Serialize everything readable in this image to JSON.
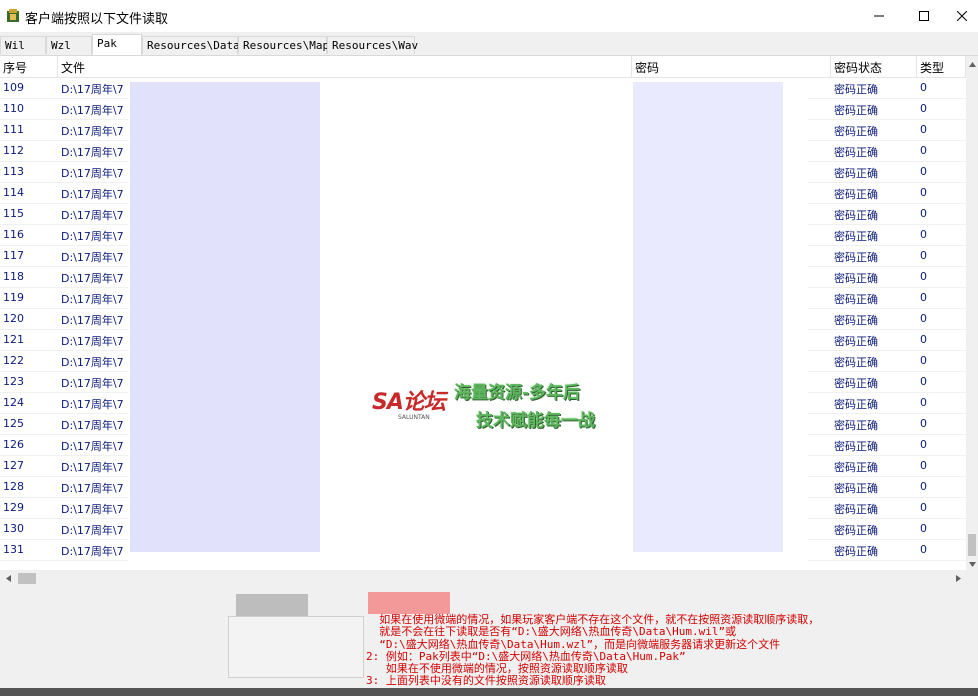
{
  "window": {
    "title": "客户端按照以下文件读取"
  },
  "tabs": [
    {
      "label": "Wil",
      "active": false
    },
    {
      "label": "Wzl",
      "active": false
    },
    {
      "label": "Pak",
      "active": true
    },
    {
      "label": "Resources\\Data",
      "active": false
    },
    {
      "label": "Resources\\Map",
      "active": false
    },
    {
      "label": "Resources\\Wav",
      "active": false
    }
  ],
  "table": {
    "columns": [
      "序号",
      "文件",
      "密码",
      "密码状态",
      "类型"
    ],
    "rows": [
      {
        "seq": "109",
        "file": "D:\\17周年\\7",
        "status": "密码正确",
        "type": "0"
      },
      {
        "seq": "110",
        "file": "D:\\17周年\\7",
        "status": "密码正确",
        "type": "0"
      },
      {
        "seq": "111",
        "file": "D:\\17周年\\7",
        "status": "密码正确",
        "type": "0"
      },
      {
        "seq": "112",
        "file": "D:\\17周年\\7",
        "status": "密码正确",
        "type": "0"
      },
      {
        "seq": "113",
        "file": "D:\\17周年\\7",
        "status": "密码正确",
        "type": "0"
      },
      {
        "seq": "114",
        "file": "D:\\17周年\\7",
        "status": "密码正确",
        "type": "0"
      },
      {
        "seq": "115",
        "file": "D:\\17周年\\7",
        "status": "密码正确",
        "type": "0"
      },
      {
        "seq": "116",
        "file": "D:\\17周年\\7",
        "status": "密码正确",
        "type": "0"
      },
      {
        "seq": "117",
        "file": "D:\\17周年\\7",
        "status": "密码正确",
        "type": "0"
      },
      {
        "seq": "118",
        "file": "D:\\17周年\\7",
        "status": "密码正确",
        "type": "0"
      },
      {
        "seq": "119",
        "file": "D:\\17周年\\7",
        "status": "密码正确",
        "type": "0"
      },
      {
        "seq": "120",
        "file": "D:\\17周年\\7",
        "status": "密码正确",
        "type": "0"
      },
      {
        "seq": "121",
        "file": "D:\\17周年\\7",
        "status": "密码正确",
        "type": "0"
      },
      {
        "seq": "122",
        "file": "D:\\17周年\\7",
        "status": "密码正确",
        "type": "0"
      },
      {
        "seq": "123",
        "file": "D:\\17周年\\7",
        "status": "密码正确",
        "type": "0"
      },
      {
        "seq": "124",
        "file": "D:\\17周年\\7",
        "status": "密码正确",
        "type": "0"
      },
      {
        "seq": "125",
        "file": "D:\\17周年\\7",
        "status": "密码正确",
        "type": "0"
      },
      {
        "seq": "126",
        "file": "D:\\17周年\\7",
        "status": "密码正确",
        "type": "0"
      },
      {
        "seq": "127",
        "file": "D:\\17周年\\7",
        "status": "密码正确",
        "type": "0"
      },
      {
        "seq": "128",
        "file": "D:\\17周年\\7",
        "status": "密码正确",
        "type": "0"
      },
      {
        "seq": "129",
        "file": "D:\\17周年\\7",
        "status": "密码正确",
        "type": "0"
      },
      {
        "seq": "130",
        "file": "D:\\17周年\\7",
        "status": "密码正确",
        "type": "0"
      },
      {
        "seq": "131",
        "file": "D:\\17周年\\7",
        "status": "密码正确",
        "type": "0"
      }
    ]
  },
  "watermark": {
    "logo": "SA论坛",
    "logo_sub": "SALUNTAN",
    "line1": "海量资源-多年后",
    "line2": "技术赋能每一战"
  },
  "notes": {
    "lines": [
      "  如果在使用微端的情况，如果玩家客户端不存在这个文件，就不在按照资源读取顺序读取，",
      "  就是不会在往下读取是否有“D:\\盛大网络\\热血传奇\\Data\\Hum.wil”或",
      "  “D:\\盛大网络\\热血传奇\\Data\\Hum.wzl”，而是向微端服务器请求更新这个文件",
      "2: 例如：Pak列表中“D:\\盛大网络\\热血传奇\\Data\\Hum.Pak”",
      "   如果在不使用微端的情况，按照资源读取顺序读取",
      "3: 上面列表中没有的文件按照资源读取顺序读取"
    ]
  },
  "colors": {
    "row_text": "#0a1a7a",
    "note_text": "#d40000",
    "watermark_green": "#5fb85f",
    "logo_red": "#c82a2a"
  }
}
